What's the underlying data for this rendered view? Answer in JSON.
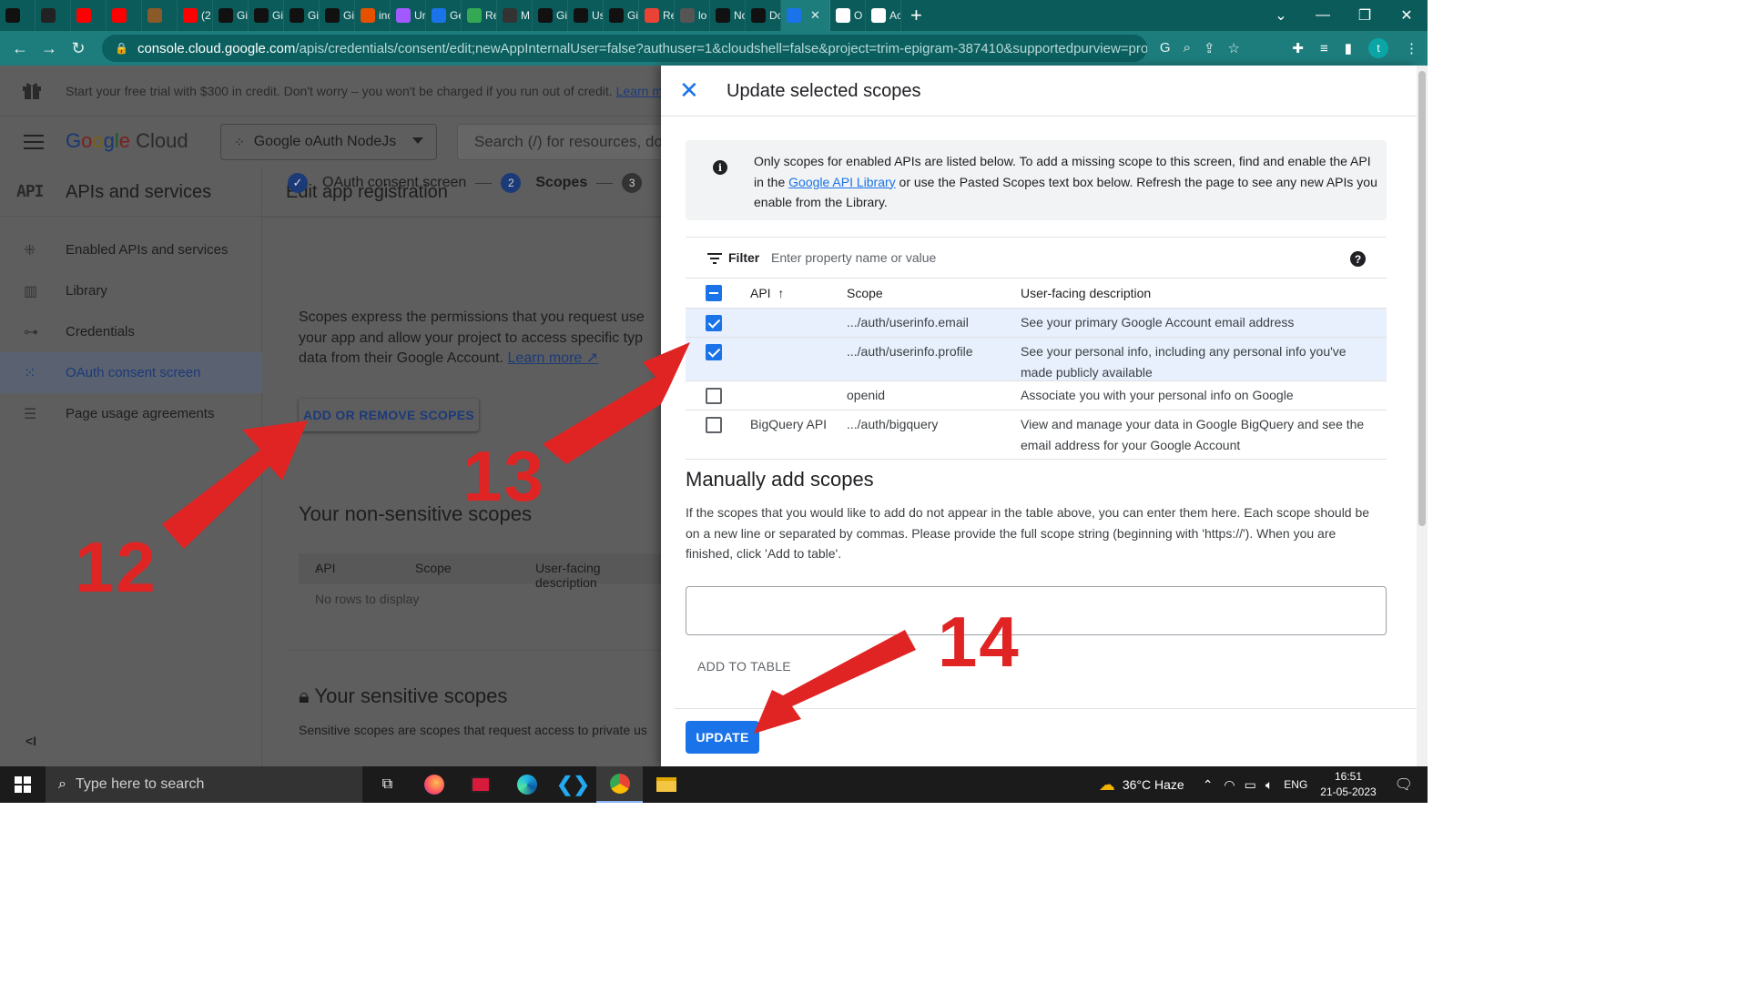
{
  "browser": {
    "tabs": [
      {
        "label": "",
        "icon": "k-icon",
        "color": "#111111"
      },
      {
        "label": "",
        "icon": "mg-icon",
        "color": "#222222"
      },
      {
        "label": "",
        "icon": "youtube-icon",
        "color": "#ff0000"
      },
      {
        "label": "",
        "icon": "youtube-icon",
        "color": "#ff0000"
      },
      {
        "label": "",
        "icon": "owl-icon",
        "color": "#8a5a2a"
      },
      {
        "label": "(2",
        "icon": "youtube-icon",
        "color": "#ff0000"
      },
      {
        "label": "Gi",
        "icon": "github-icon",
        "color": "#111111"
      },
      {
        "label": "Gi",
        "icon": "github-icon",
        "color": "#111111"
      },
      {
        "label": "Gi",
        "icon": "github-icon",
        "color": "#111111"
      },
      {
        "label": "Gi",
        "icon": "github-icon",
        "color": "#111111"
      },
      {
        "label": "inc",
        "icon": "bars-icon",
        "color": "#e65100"
      },
      {
        "label": "Ur",
        "icon": "figma-icon",
        "color": "#a259ff"
      },
      {
        "label": "Ge",
        "icon": "flag-icon",
        "color": "#1a73e8"
      },
      {
        "label": "Re",
        "icon": "four-icon",
        "color": "#34a853"
      },
      {
        "label": "M",
        "icon": "info-icon",
        "color": "#333333"
      },
      {
        "label": "Gi",
        "icon": "github-icon",
        "color": "#111111"
      },
      {
        "label": "Us",
        "icon": "p-icon",
        "color": "#111111"
      },
      {
        "label": "Gi",
        "icon": "github-icon",
        "color": "#111111"
      },
      {
        "label": "Re",
        "icon": "gmail-icon",
        "color": "#ea4335"
      },
      {
        "label": "lo",
        "icon": "globe-icon",
        "color": "#555555"
      },
      {
        "label": "Nc",
        "icon": "medium-icon",
        "color": "#111111"
      },
      {
        "label": "Dc",
        "icon": "p-icon",
        "color": "#111111"
      },
      {
        "label": "",
        "icon": "api-icon",
        "color": "#1a73e8",
        "active": true
      },
      {
        "label": "O",
        "icon": "google-icon",
        "color": "#ffffff"
      },
      {
        "label": "Ac",
        "icon": "wikipedia-icon",
        "color": "#ffffff"
      }
    ],
    "url_host": "console.cloud.google.com",
    "url_rest": "/apis/credentials/consent/edit;newAppInternalUser=false?authuser=1&cloudshell=false&project=trim-epigram-387410&supportedpurview=project",
    "profile_letter": "t"
  },
  "promo": {
    "text": "Start your free trial with $300 in credit. Don't worry – you won't be charged if you run out of credit.",
    "learn_more": "Learn more"
  },
  "header": {
    "project": "Google oAuth NodeJs",
    "search_placeholder": "Search (/) for resources, do"
  },
  "sidebar": {
    "section_icon": "API",
    "title": "APIs and services",
    "items": [
      {
        "label": "Enabled APIs and services",
        "icon": "diamond-icon"
      },
      {
        "label": "Library",
        "icon": "library-icon"
      },
      {
        "label": "Credentials",
        "icon": "key-icon"
      },
      {
        "label": "OAuth consent screen",
        "icon": "consent-icon",
        "active": true
      },
      {
        "label": "Page usage agreements",
        "icon": "settings-list-icon"
      }
    ],
    "collapse": "<I"
  },
  "edit": {
    "title": "Edit app registration",
    "step1": "OAuth consent screen",
    "step2_num": "2",
    "step2": "Scopes",
    "step3_num": "3",
    "desc_line1": "Scopes express the permissions that you request use",
    "desc_line2": "your app and allow your project to access specific typ",
    "desc_line3": "data from their Google Account.",
    "learn_more": "Learn more",
    "add_remove": "ADD OR REMOVE SCOPES",
    "nonsensitive_title": "Your non-sensitive scopes",
    "col_api": "API",
    "col_scope": "Scope",
    "col_desc": "User-facing description",
    "no_rows": "No rows to display",
    "sensitive_title": "Your sensitive scopes",
    "sensitive_desc": "Sensitive scopes are scopes that request access to private us"
  },
  "dialog": {
    "title": "Update selected scopes",
    "info_part1": "Only scopes for enabled APIs are listed below. To add a missing scope to this screen, find and enable the API in the",
    "info_link": "Google API Library",
    "info_part2": "or use the Pasted Scopes text box below. Refresh the page to see any new APIs you enable from the Library.",
    "filter_label": "Filter",
    "filter_placeholder": "Enter property name or value",
    "col_api": "API",
    "col_scope": "Scope",
    "col_desc": "User-facing description",
    "rows": [
      {
        "api": "",
        "scope": ".../auth/userinfo.email",
        "desc": "See your primary Google Account email address",
        "checked": true
      },
      {
        "api": "",
        "scope": ".../auth/userinfo.profile",
        "desc": "See your personal info, including any personal info you've made publicly available",
        "checked": true
      },
      {
        "api": "",
        "scope": "openid",
        "desc": "Associate you with your personal info on Google",
        "checked": false
      },
      {
        "api": "BigQuery API",
        "scope": ".../auth/bigquery",
        "desc": "View and manage your data in Google BigQuery and see the email address for your Google Account",
        "checked": false
      }
    ],
    "manual_title": "Manually add scopes",
    "manual_desc": "If the scopes that you would like to add do not appear in the table above, you can enter them here. Each scope should be on a new line or separated by commas. Please provide the full scope string (beginning with 'https://'). When you are finished, click 'Add to table'.",
    "manual_value": "",
    "add_to_table": "ADD TO TABLE",
    "update": "UPDATE"
  },
  "annotations": {
    "n12": "12",
    "n13": "13",
    "n14": "14",
    "arrow_color": "#e02424"
  },
  "taskbar": {
    "search_placeholder": "Type here to search",
    "weather": "36°C  Haze",
    "lang": "ENG",
    "time": "16:51",
    "date": "21-05-2023"
  }
}
